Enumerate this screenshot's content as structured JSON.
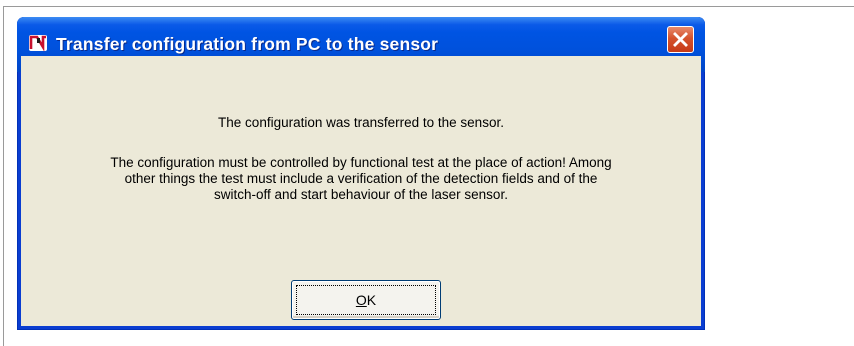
{
  "dialog": {
    "title": "Transfer configuration from PC to the sensor",
    "message_line1": "The configuration was transferred to the sensor.",
    "message_paragraph": [
      "The configuration must be controlled by functional test at the place of action! Among",
      "other things the test must include a verification of the detection fields and of the",
      "switch-off and start behaviour of the laser sensor."
    ],
    "ok_button": {
      "mnemonic": "O",
      "rest": "K"
    },
    "icons": {
      "title_icon": "app-logo-icon",
      "close_icon": "close-icon"
    }
  },
  "colors": {
    "titlebar": "#0054e3",
    "client_background": "#ece9d8",
    "close_button": "#d5532d"
  }
}
